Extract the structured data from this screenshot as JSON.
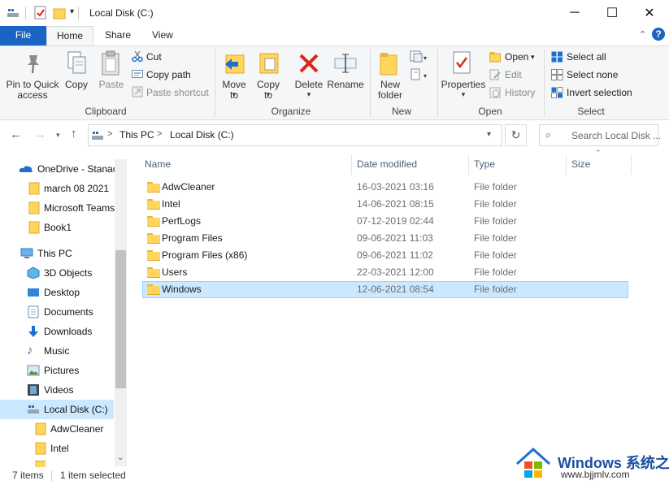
{
  "window": {
    "title": "Local Disk (C:)",
    "minimize_glyph": "─",
    "maximize_glyph": "☐",
    "close_glyph": "✕"
  },
  "ribbon_tabs": [
    "File",
    "Home",
    "Share",
    "View"
  ],
  "ribbon": {
    "clipboard": {
      "group_label": "Clipboard",
      "pin_label": "Pin to Quick access",
      "copy_label": "Copy",
      "paste_label": "Paste",
      "cut_label": "Cut",
      "copy_path_label": "Copy path",
      "paste_shortcut_label": "Paste shortcut"
    },
    "organize": {
      "group_label": "Organize",
      "move_to_label": "Move to",
      "copy_to_label": "Copy to",
      "delete_label": "Delete",
      "rename_label": "Rename"
    },
    "new": {
      "group_label": "New",
      "new_folder_label": "New folder"
    },
    "open": {
      "group_label": "Open",
      "properties_label": "Properties",
      "open_label": "Open",
      "edit_label": "Edit",
      "history_label": "History"
    },
    "select": {
      "group_label": "Select",
      "select_all_label": "Select all",
      "select_none_label": "Select none",
      "invert_label": "Invert selection"
    }
  },
  "address": {
    "crumbs": [
      "This PC",
      "Local Disk (C:)"
    ],
    "separator": ">",
    "search_placeholder": "Search Local Disk ..."
  },
  "nav": {
    "onedrive": "OneDrive - Stanac",
    "quick_items": [
      "march 08 2021",
      "Microsoft Teams",
      "Book1"
    ],
    "this_pc": "This PC",
    "pc_items": [
      "3D Objects",
      "Desktop",
      "Documents",
      "Downloads",
      "Music",
      "Pictures",
      "Videos",
      "Local Disk (C:)"
    ],
    "sub_items": [
      "AdwCleaner",
      "Intel"
    ]
  },
  "columns": {
    "name": "Name",
    "date": "Date modified",
    "type": "Type",
    "size": "Size"
  },
  "files": [
    {
      "name": "AdwCleaner",
      "date": "16-03-2021 03:16",
      "type": "File folder"
    },
    {
      "name": "Intel",
      "date": "14-06-2021 08:15",
      "type": "File folder"
    },
    {
      "name": "PerfLogs",
      "date": "07-12-2019 02:44",
      "type": "File folder"
    },
    {
      "name": "Program Files",
      "date": "09-06-2021 11:03",
      "type": "File folder"
    },
    {
      "name": "Program Files (x86)",
      "date": "09-06-2021 11:02",
      "type": "File folder"
    },
    {
      "name": "Users",
      "date": "22-03-2021 12:00",
      "type": "File folder"
    },
    {
      "name": "Windows",
      "date": "12-06-2021 08:54",
      "type": "File folder"
    }
  ],
  "status": {
    "items": "7 items",
    "selected": "1 item selected"
  },
  "watermark": {
    "title": "Windows 系统之家",
    "url": "www.bjjmlv.com"
  },
  "colors": {
    "accent": "#1a64c4",
    "selection": "#cce8ff",
    "folder": "#ffd55c",
    "delete_red": "#d9281a"
  }
}
